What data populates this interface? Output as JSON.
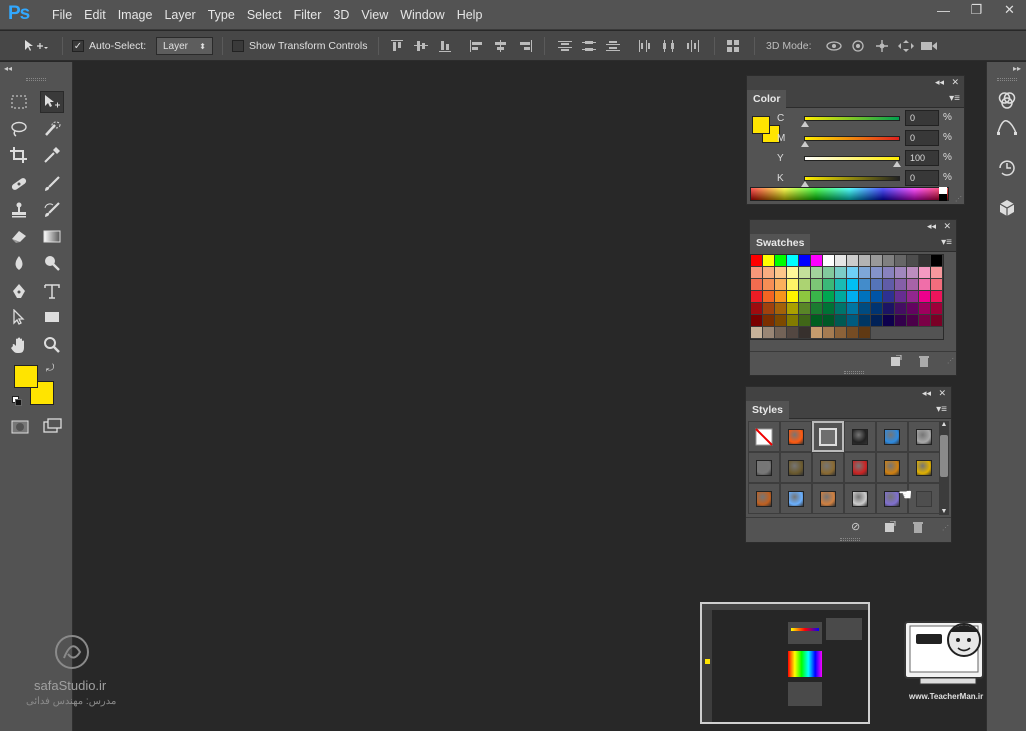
{
  "app": {
    "logo": "Ps"
  },
  "menu": [
    "File",
    "Edit",
    "Image",
    "Layer",
    "Type",
    "Select",
    "Filter",
    "3D",
    "View",
    "Window",
    "Help"
  ],
  "window_controls": {
    "minimize": "—",
    "restore": "❐",
    "close": "✕"
  },
  "options": {
    "auto_select_label": "Auto-Select:",
    "auto_select_checked": "✓",
    "auto_select_value": "Layer",
    "show_transform_label": "Show Transform Controls",
    "mode_3d_label": "3D Mode:"
  },
  "color_panel": {
    "tab": "Color",
    "channels": [
      {
        "label": "C",
        "value": "0",
        "unit": "%",
        "gradient": [
          "#ffee00",
          "#00a050"
        ],
        "level": 0
      },
      {
        "label": "M",
        "value": "0",
        "unit": "%",
        "gradient": [
          "#ffee00",
          "#e02020"
        ],
        "level": 0
      },
      {
        "label": "Y",
        "value": "100",
        "unit": "%",
        "gradient": [
          "#ffffff",
          "#ffee00"
        ],
        "level": 1
      },
      {
        "label": "K",
        "value": "0",
        "unit": "%",
        "gradient": [
          "#ffee00",
          "#222222"
        ],
        "level": 0
      }
    ],
    "foreground": "#ffe400",
    "background": "#ffe400"
  },
  "swatches_panel": {
    "tab": "Swatches",
    "rows": [
      [
        "#ff0000",
        "#ffff00",
        "#00ff00",
        "#00ffff",
        "#0000ff",
        "#ff00ff",
        "#ffffff",
        "#e6e6e6",
        "#cccccc",
        "#b3b3b3",
        "#999999",
        "#808080",
        "#666666",
        "#4d4d4d",
        "#333333",
        "#000000"
      ],
      [
        "#f7977a",
        "#f9ad81",
        "#fdc68a",
        "#fff79a",
        "#c4df9b",
        "#a3d39c",
        "#82ca9d",
        "#7bcdc8",
        "#6ecff6",
        "#7ea7d8",
        "#8493ca",
        "#8882be",
        "#a187be",
        "#bc8dbf",
        "#f49ac2",
        "#f6989d"
      ],
      [
        "#f26c4f",
        "#f68e55",
        "#fbaf5c",
        "#fff467",
        "#acd372",
        "#7cc576",
        "#3bb878",
        "#1abbb4",
        "#00bff3",
        "#438ccb",
        "#5574b9",
        "#605ca8",
        "#855fa8",
        "#a763a8",
        "#f06ea9",
        "#f26d7d"
      ],
      [
        "#ed1c24",
        "#f26522",
        "#f7941d",
        "#fff200",
        "#8dc73f",
        "#39b54a",
        "#00a651",
        "#00a99d",
        "#00aeef",
        "#0072bc",
        "#0054a6",
        "#2e3192",
        "#662d91",
        "#92278f",
        "#ec008c",
        "#ed145b"
      ],
      [
        "#9e0b0f",
        "#a0410d",
        "#a36209",
        "#aba000",
        "#598527",
        "#1a7b30",
        "#007236",
        "#00746b",
        "#0076a3",
        "#004b80",
        "#003471",
        "#1b1464",
        "#440e62",
        "#630460",
        "#9e005d",
        "#9e0039"
      ],
      [
        "#790000",
        "#7b2e00",
        "#7d4900",
        "#827b00",
        "#406618",
        "#005e20",
        "#005826",
        "#005952",
        "#005b7f",
        "#003663",
        "#002157",
        "#0d004c",
        "#32004b",
        "#4b0049",
        "#7b0046",
        "#7a0026"
      ],
      [
        "#c7b299",
        "#998675",
        "#736357",
        "#534741",
        "#37302d",
        "#c69c6d",
        "#a67c52",
        "#8c6239",
        "#754c24",
        "#603913"
      ]
    ]
  },
  "styles_panel": {
    "tab": "Styles",
    "cells": [
      {
        "name": "none-style",
        "color": "#ffffff"
      },
      {
        "name": "fire-style",
        "color": "#ff5a10"
      },
      {
        "name": "frame-style",
        "color": "#707070"
      },
      {
        "name": "chrome-ball-style",
        "color": "#222222"
      },
      {
        "name": "blue-glass-style",
        "color": "#2d8ae0"
      },
      {
        "name": "gray-style",
        "color": "#a8a8a8"
      },
      {
        "name": "dark-gradient-style",
        "color": "#777777"
      },
      {
        "name": "olive-style",
        "color": "#6b5a2e"
      },
      {
        "name": "bronze-style",
        "color": "#8a6a32"
      },
      {
        "name": "red-button-style",
        "color": "#cc2222"
      },
      {
        "name": "multicolor-style",
        "color": "#d08010"
      },
      {
        "name": "gold-style",
        "color": "#e0b000"
      },
      {
        "name": "copper-style",
        "color": "#c06020"
      },
      {
        "name": "sky-style",
        "color": "#6ab0ff"
      },
      {
        "name": "sunset-style",
        "color": "#d08040"
      },
      {
        "name": "pattern-style",
        "color": "#cccccc"
      },
      {
        "name": "purple-glass-style",
        "color": "#8070d0"
      },
      {
        "name": "empty-style",
        "color": "#555555"
      }
    ]
  },
  "watermark_left": {
    "brand": "safaStudio.ir",
    "teacher": "مدرس: مهندس فدائی"
  },
  "watermark_right": {
    "site": "www.TeacherMan.ir",
    "brand": "TeacherMan"
  }
}
